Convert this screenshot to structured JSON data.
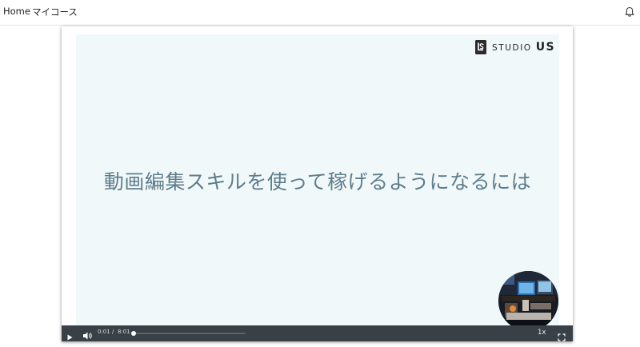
{
  "nav": {
    "home_label": "Home",
    "mycourse_label": "マイコース",
    "notification_icon": "bell-icon"
  },
  "slide": {
    "logo_text": "STUDIO",
    "logo_text_bold": "US",
    "logo_icon": "studio-us-logo-icon",
    "title": "動画編集スキルを使って稼げるようになるには",
    "title_color": "#5f7d8b",
    "background_color": "#f0f8fa"
  },
  "player": {
    "play_icon": "play-icon",
    "volume_icon": "volume-icon",
    "fullscreen_icon": "fullscreen-icon",
    "current_time": "0:01",
    "separator": "/",
    "duration": "8:01",
    "progress_fraction": 0.002,
    "playback_rate": "1x",
    "controls_color": "#3a4146"
  }
}
